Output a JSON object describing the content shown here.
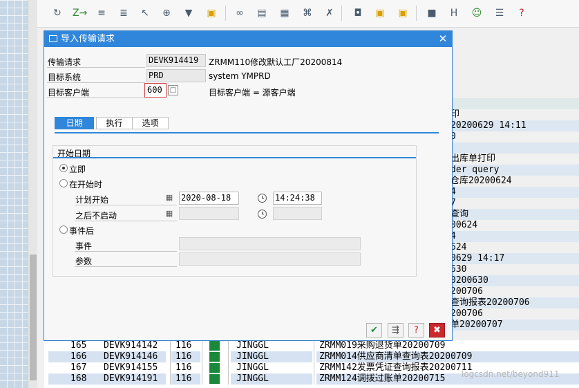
{
  "dialog": {
    "title": "导入传输请求",
    "fields": {
      "request_label": "传输请求",
      "request_value": "DEVK914419",
      "request_desc": "ZRMM110修改默认工厂20200814",
      "system_label": "目标系统",
      "system_value": "PRD",
      "system_desc": "system YMPRD",
      "client_label": "目标客户端",
      "client_value": "600",
      "client_desc": "目标客户端 = 源客户端"
    },
    "tabs": [
      "日期",
      "执行",
      "选项"
    ],
    "group": {
      "title": "开始日期",
      "immediate_label": "立即",
      "at_start_label": "在开始时",
      "planned_start_label": "计划开始",
      "planned_date": "2020-08-18",
      "planned_time": "14:24:38",
      "no_start_after_label": "之后不启动",
      "after_event_label": "事件后",
      "event_label": "事件",
      "parameter_label": "参数",
      "selected": "立即"
    }
  },
  "right_list": [
    "印",
    "20200629 14:11",
    "0",
    "",
    "出库单打印",
    "der query",
    "仓库20200624",
    "4",
    "7",
    "查询",
    "00624",
    "4",
    "624",
    "0629 14:17",
    "630",
    "0200630",
    "200706",
    "查询报表20200706",
    "200706",
    "单20200707"
  ],
  "bottom_table": [
    {
      "no": "165",
      "request": "DEVK914142",
      "client": "116",
      "user": "JINGGL",
      "desc": "ZRMM019采购退货单20200709"
    },
    {
      "no": "166",
      "request": "DEVK914146",
      "client": "116",
      "user": "JINGGL",
      "desc": "ZRMM014供应商清单查询表20200709"
    },
    {
      "no": "167",
      "request": "DEVK914155",
      "client": "116",
      "user": "JINGGL",
      "desc": "ZRMM142发票凭证查询报表20200711"
    },
    {
      "no": "168",
      "request": "DEVK914191",
      "client": "116",
      "user": "JINGGL",
      "desc": "ZRMM124调拨过账单20200715"
    }
  ],
  "watermark": "logcsdn.net/beyond911",
  "colors": {
    "accent": "#2f86da",
    "status_ok": "#1a8a3a",
    "danger": "#c0282c"
  },
  "icons": {
    "title": "transport-request-icon",
    "close": "close-icon",
    "f4_help": "value-help-icon",
    "calendar": "calendar-icon",
    "clock": "clock-icon",
    "ok": "check-icon",
    "schedule": "schedule-icon",
    "help": "help-icon",
    "cancel": "cancel-icon"
  }
}
